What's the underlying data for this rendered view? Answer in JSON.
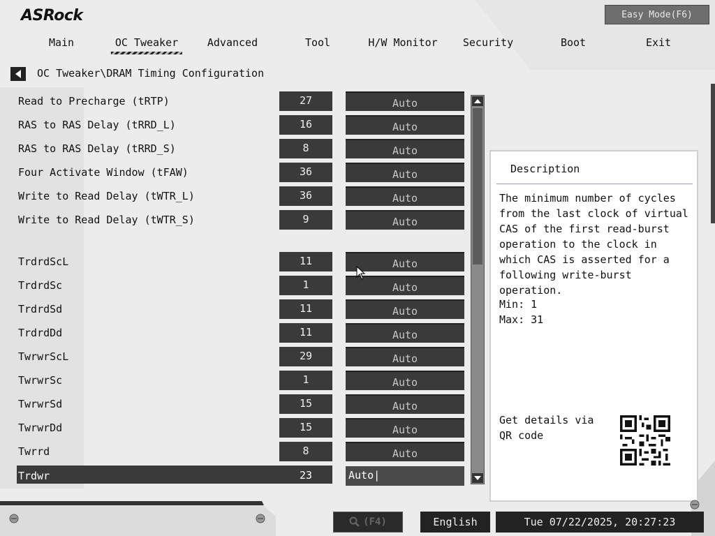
{
  "brand": {
    "logo_text": "ASRock"
  },
  "header": {
    "easy_mode_label": "Easy Mode(F6)"
  },
  "nav": {
    "items": [
      {
        "label": "Main"
      },
      {
        "label": "OC Tweaker",
        "active": true
      },
      {
        "label": "Advanced"
      },
      {
        "label": "Tool"
      },
      {
        "label": "H/W Monitor"
      },
      {
        "label": "Security"
      },
      {
        "label": "Boot"
      },
      {
        "label": "Exit"
      }
    ]
  },
  "breadcrumb": "OC Tweaker\\DRAM Timing Configuration",
  "settings": [
    {
      "label": "Read to Precharge (tRTP)",
      "value": "27",
      "setting": "Auto"
    },
    {
      "label": "RAS to RAS Delay (tRRD_L)",
      "value": "16",
      "setting": "Auto"
    },
    {
      "label": "RAS to RAS Delay (tRRD_S)",
      "value": "8",
      "setting": "Auto"
    },
    {
      "label": "Four Activate Window (tFAW)",
      "value": "36",
      "setting": "Auto"
    },
    {
      "label": "Write to Read Delay (tWTR_L)",
      "value": "36",
      "setting": "Auto"
    },
    {
      "label": "Write to Read Delay (tWTR_S)",
      "value": "9",
      "setting": "Auto"
    },
    {
      "label": "TrdrdScL",
      "value": "11",
      "setting": "Auto"
    },
    {
      "label": "TrdrdSc",
      "value": "1",
      "setting": "Auto"
    },
    {
      "label": "TrdrdSd",
      "value": "11",
      "setting": "Auto"
    },
    {
      "label": "TrdrdDd",
      "value": "11",
      "setting": "Auto"
    },
    {
      "label": "TwrwrScL",
      "value": "29",
      "setting": "Auto"
    },
    {
      "label": "TwrwrSc",
      "value": "1",
      "setting": "Auto"
    },
    {
      "label": "TwrwrSd",
      "value": "15",
      "setting": "Auto"
    },
    {
      "label": "TwrwrDd",
      "value": "15",
      "setting": "Auto"
    },
    {
      "label": "Twrrd",
      "value": "8",
      "setting": "Auto"
    },
    {
      "label": "Trdwr",
      "value": "23",
      "setting": "Auto|",
      "selected": true
    }
  ],
  "description": {
    "title": "Description",
    "text": "The minimum number of cycles from the last clock of virtual CAS of the first read-burst operation to the clock in which CAS is asserted for a following write-burst operation.",
    "min": "Min: 1",
    "max": "Max: 31",
    "qr_label": "Get details via QR code"
  },
  "footer": {
    "search_label": "(F4)",
    "language": "English",
    "datetime": "Tue 07/22/2025, 20:27:23"
  },
  "colors": {
    "panel_dark": "#3a3a3a",
    "accent_text": "#ffffff",
    "background": "#ececec"
  },
  "icons": [
    "back-arrow-icon",
    "scroll-up-icon",
    "scroll-down-icon",
    "search-icon",
    "qr-code-icon",
    "mouse-cursor-icon"
  ]
}
